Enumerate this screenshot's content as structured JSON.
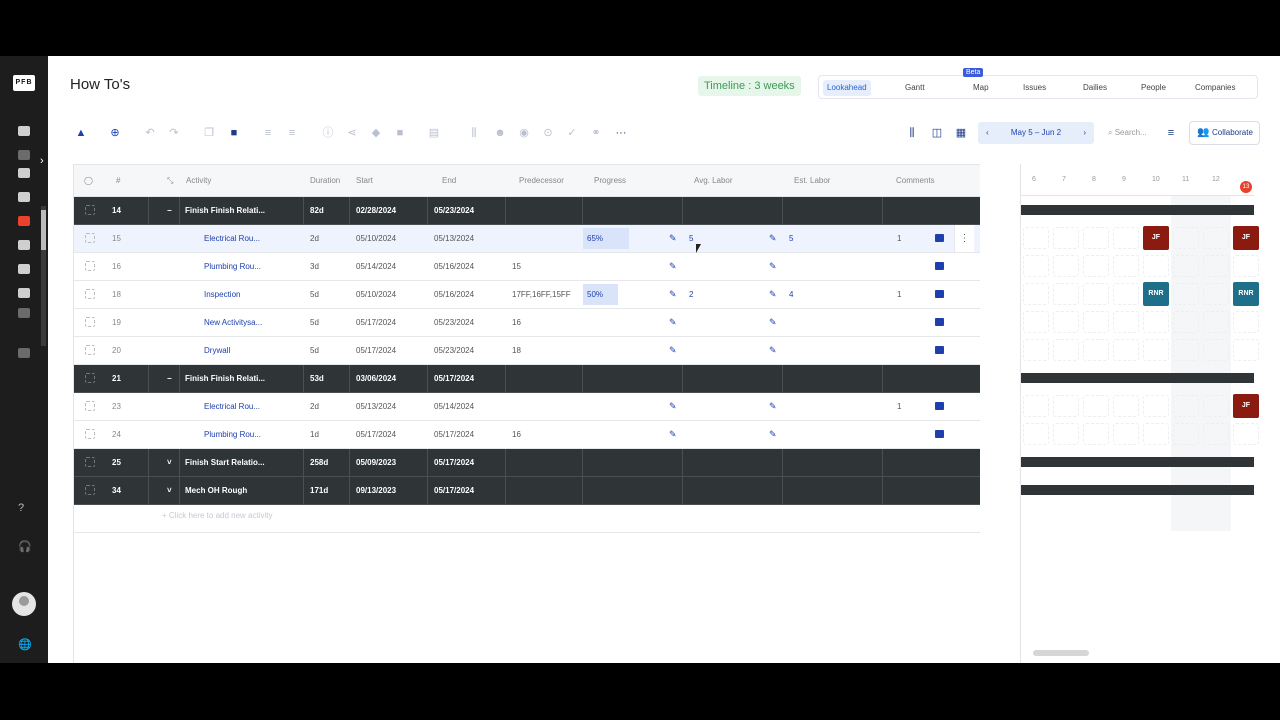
{
  "app": {
    "title": "How To's",
    "timeline_badge": "Timeline : 3 weeks"
  },
  "sidebar": {
    "logo": "PFB",
    "help_icon": "?",
    "headset_icon": "🎧",
    "globe_icon": "🌐"
  },
  "view_tabs": [
    {
      "label": "Lookahead",
      "active": true
    },
    {
      "label": "Gantt",
      "active": false
    },
    {
      "label": "Map",
      "active": false
    },
    {
      "label": "Issues",
      "active": false
    },
    {
      "label": "Dailies",
      "active": false
    },
    {
      "label": "People",
      "active": false
    },
    {
      "label": "Companies",
      "active": false
    }
  ],
  "beta_label": "Beta",
  "toolbar": {
    "date_range": "May 5 – Jun 2",
    "search_placeholder": "Search...",
    "collaborate_label": "Collaborate",
    "more": "···"
  },
  "columns": [
    "#",
    "Activity",
    "Duration",
    "Start",
    "End",
    "Predecessor",
    "Progress",
    "Avg. Labor",
    "Est. Labor",
    "Comments"
  ],
  "rows": [
    {
      "id": "14",
      "activity": "Finish Finish Relati...",
      "duration": "82d",
      "start": "02/28/2024",
      "end": "05/23/2024",
      "pred": "",
      "progress": "",
      "avg": "",
      "est": "",
      "comments": "",
      "parent": true,
      "toggle": "−"
    },
    {
      "id": "15",
      "activity": "Electrical Rou...",
      "duration": "2d",
      "start": "05/10/2024",
      "end": "05/13/2024",
      "pred": "",
      "progress": "65%",
      "progress_value": 0.65,
      "avg": "5",
      "est": "5",
      "comments": "1",
      "parent": false,
      "selected": true
    },
    {
      "id": "16",
      "activity": "Plumbing Rou...",
      "duration": "3d",
      "start": "05/14/2024",
      "end": "05/16/2024",
      "pred": "15",
      "progress": "",
      "avg": "",
      "est": "",
      "comments": "",
      "parent": false
    },
    {
      "id": "18",
      "activity": "Inspection",
      "duration": "5d",
      "start": "05/10/2024",
      "end": "05/16/2024",
      "pred": "17FF,16FF,15FF",
      "progress": "50%",
      "progress_value": 0.5,
      "avg": "2",
      "est": "4",
      "comments": "1",
      "parent": false
    },
    {
      "id": "19",
      "activity": "New Activitysa...",
      "duration": "5d",
      "start": "05/17/2024",
      "end": "05/23/2024",
      "pred": "16",
      "progress": "",
      "avg": "",
      "est": "",
      "comments": "",
      "parent": false
    },
    {
      "id": "20",
      "activity": "Drywall",
      "duration": "5d",
      "start": "05/17/2024",
      "end": "05/23/2024",
      "pred": "18",
      "progress": "",
      "avg": "",
      "est": "",
      "comments": "",
      "parent": false
    },
    {
      "id": "21",
      "activity": "Finish Finish Relati...",
      "duration": "53d",
      "start": "03/06/2024",
      "end": "05/17/2024",
      "pred": "",
      "progress": "",
      "avg": "",
      "est": "",
      "comments": "",
      "parent": true,
      "toggle": "−"
    },
    {
      "id": "23",
      "activity": "Electrical Rou...",
      "duration": "2d",
      "start": "05/13/2024",
      "end": "05/14/2024",
      "pred": "",
      "progress": "",
      "avg": "",
      "est": "",
      "comments": "1",
      "parent": false
    },
    {
      "id": "24",
      "activity": "Plumbing Rou...",
      "duration": "1d",
      "start": "05/17/2024",
      "end": "05/17/2024",
      "pred": "16",
      "progress": "",
      "avg": "",
      "est": "",
      "comments": "",
      "parent": false
    },
    {
      "id": "25",
      "activity": "Finish Start Relatio...",
      "duration": "258d",
      "start": "05/09/2023",
      "end": "05/17/2024",
      "pred": "",
      "progress": "",
      "avg": "",
      "est": "",
      "comments": "",
      "parent": true,
      "toggle": "˅"
    },
    {
      "id": "34",
      "activity": "Mech OH Rough",
      "duration": "171d",
      "start": "09/13/2023",
      "end": "05/17/2024",
      "pred": "",
      "progress": "",
      "avg": "",
      "est": "",
      "comments": "",
      "parent": true,
      "toggle": "˅"
    }
  ],
  "add_row_text": "+ Click here to add new activity",
  "gantt": {
    "days": [
      "6",
      "7",
      "8",
      "9",
      "10",
      "11",
      "12",
      "13"
    ],
    "chips": [
      {
        "row": 1,
        "day_index": 4,
        "label": "JF",
        "kind": "jf"
      },
      {
        "row": 1,
        "day_index": 7,
        "label": "JF",
        "kind": "jf"
      },
      {
        "row": 3,
        "day_index": 4,
        "label": "RNR",
        "kind": "rnr"
      },
      {
        "row": 3,
        "day_index": 7,
        "label": "RNR",
        "kind": "rnr"
      },
      {
        "row": 7,
        "day_index": 7,
        "label": "JF",
        "kind": "jf"
      }
    ]
  }
}
